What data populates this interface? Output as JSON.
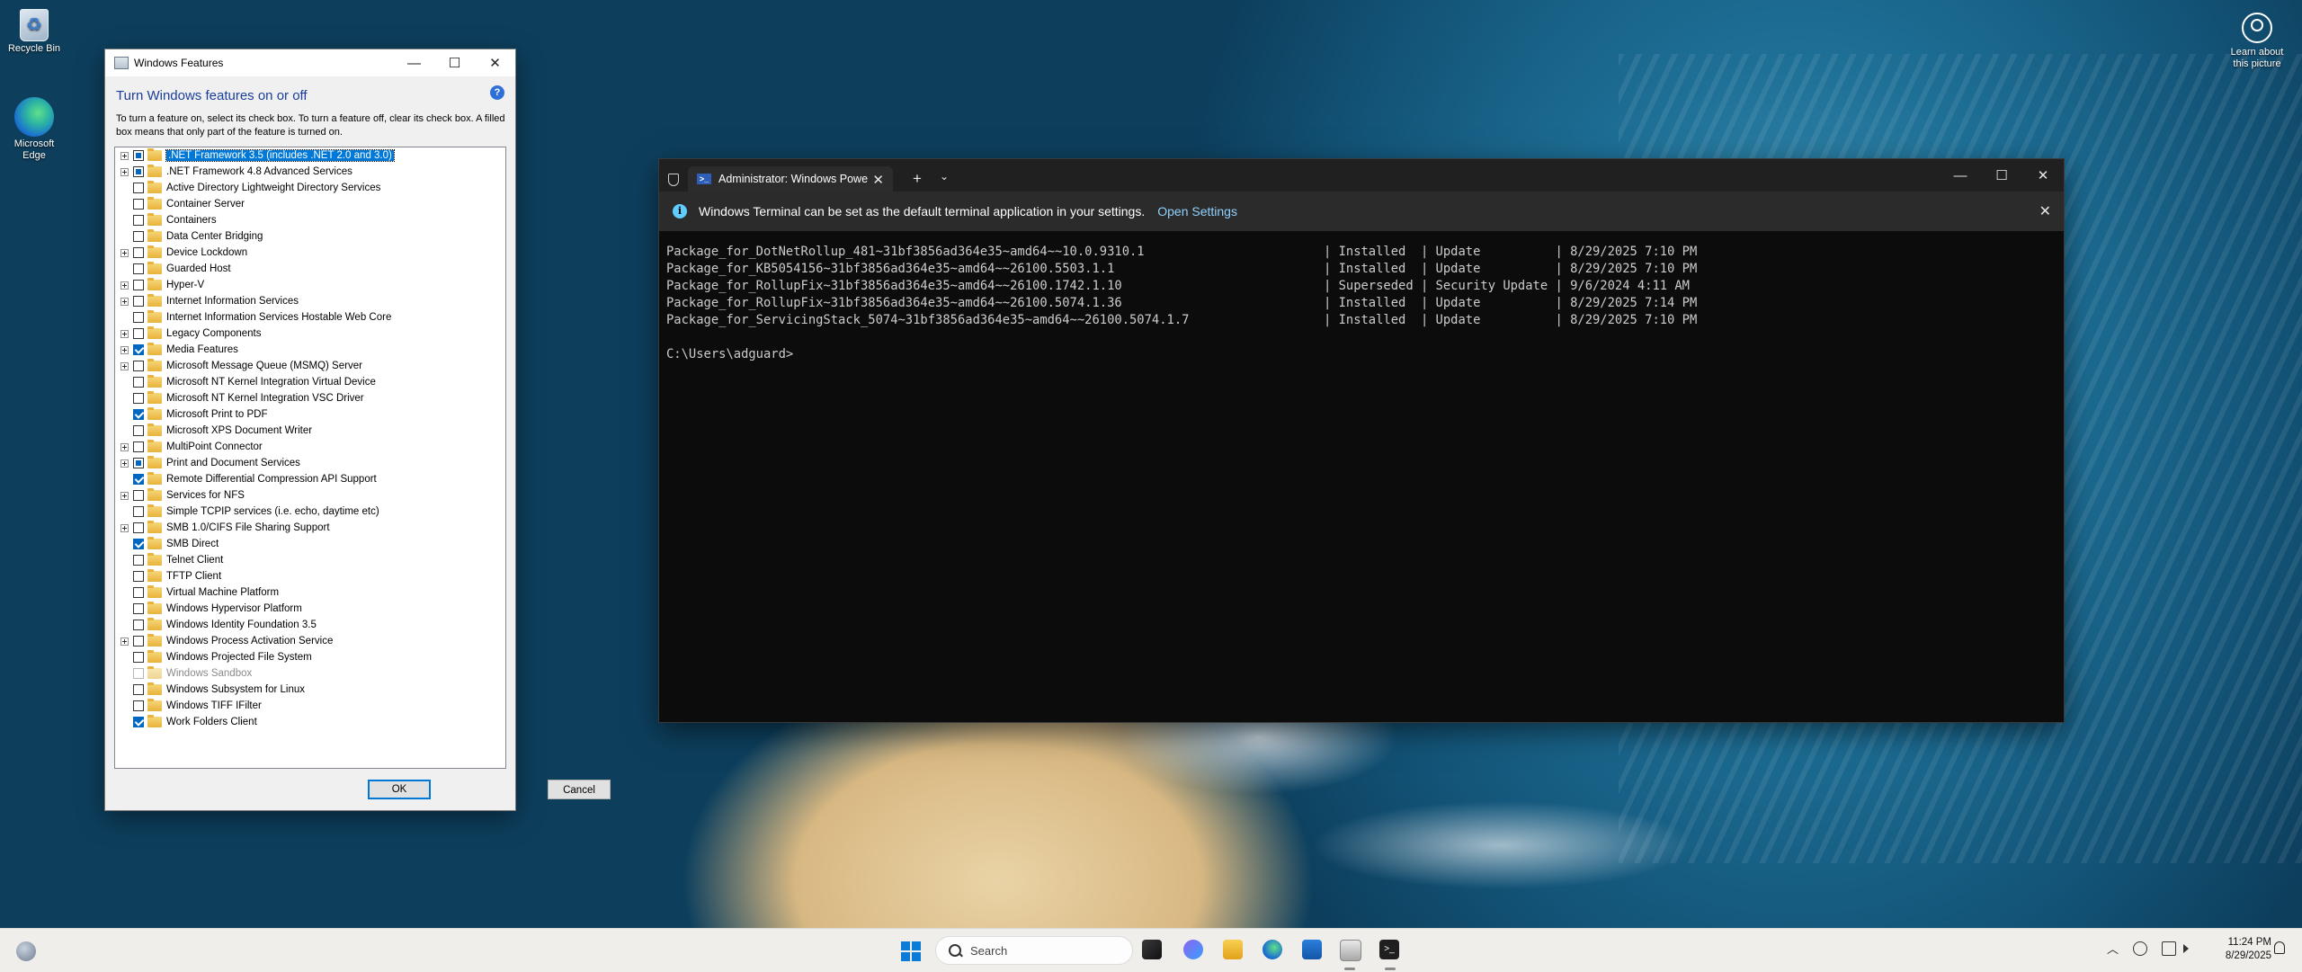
{
  "desktop": {
    "icons": [
      {
        "label": "Recycle Bin"
      },
      {
        "label": "Microsoft Edge"
      }
    ],
    "learn_label": "Learn about this picture"
  },
  "features_window": {
    "title": "Windows Features",
    "heading": "Turn Windows features on or off",
    "description": "To turn a feature on, select its check box. To turn a feature off, clear its check box. A filled box means that only part of the feature is turned on.",
    "items": [
      {
        "label": ".NET Framework 3.5 (includes .NET 2.0 and 3.0)",
        "expand": true,
        "state": "partial",
        "selected": true
      },
      {
        "label": ".NET Framework 4.8 Advanced Services",
        "expand": true,
        "state": "partial"
      },
      {
        "label": "Active Directory Lightweight Directory Services",
        "expand": false,
        "state": "off"
      },
      {
        "label": "Container Server",
        "expand": false,
        "state": "off"
      },
      {
        "label": "Containers",
        "expand": false,
        "state": "off"
      },
      {
        "label": "Data Center Bridging",
        "expand": false,
        "state": "off"
      },
      {
        "label": "Device Lockdown",
        "expand": true,
        "state": "off"
      },
      {
        "label": "Guarded Host",
        "expand": false,
        "state": "off"
      },
      {
        "label": "Hyper-V",
        "expand": true,
        "state": "off"
      },
      {
        "label": "Internet Information Services",
        "expand": true,
        "state": "off"
      },
      {
        "label": "Internet Information Services Hostable Web Core",
        "expand": false,
        "state": "off"
      },
      {
        "label": "Legacy Components",
        "expand": true,
        "state": "off"
      },
      {
        "label": "Media Features",
        "expand": true,
        "state": "checked"
      },
      {
        "label": "Microsoft Message Queue (MSMQ) Server",
        "expand": true,
        "state": "off"
      },
      {
        "label": "Microsoft NT Kernel Integration Virtual Device",
        "expand": false,
        "state": "off"
      },
      {
        "label": "Microsoft NT Kernel Integration VSC Driver",
        "expand": false,
        "state": "off"
      },
      {
        "label": "Microsoft Print to PDF",
        "expand": false,
        "state": "checked"
      },
      {
        "label": "Microsoft XPS Document Writer",
        "expand": false,
        "state": "off"
      },
      {
        "label": "MultiPoint Connector",
        "expand": true,
        "state": "off"
      },
      {
        "label": "Print and Document Services",
        "expand": true,
        "state": "partial"
      },
      {
        "label": "Remote Differential Compression API Support",
        "expand": false,
        "state": "checked"
      },
      {
        "label": "Services for NFS",
        "expand": true,
        "state": "off"
      },
      {
        "label": "Simple TCPIP services (i.e. echo, daytime etc)",
        "expand": false,
        "state": "off"
      },
      {
        "label": "SMB 1.0/CIFS File Sharing Support",
        "expand": true,
        "state": "off"
      },
      {
        "label": "SMB Direct",
        "expand": false,
        "state": "checked"
      },
      {
        "label": "Telnet Client",
        "expand": false,
        "state": "off"
      },
      {
        "label": "TFTP Client",
        "expand": false,
        "state": "off"
      },
      {
        "label": "Virtual Machine Platform",
        "expand": false,
        "state": "off"
      },
      {
        "label": "Windows Hypervisor Platform",
        "expand": false,
        "state": "off"
      },
      {
        "label": "Windows Identity Foundation 3.5",
        "expand": false,
        "state": "off"
      },
      {
        "label": "Windows Process Activation Service",
        "expand": true,
        "state": "off"
      },
      {
        "label": "Windows Projected File System",
        "expand": false,
        "state": "off"
      },
      {
        "label": "Windows Sandbox",
        "expand": false,
        "state": "disabled"
      },
      {
        "label": "Windows Subsystem for Linux",
        "expand": false,
        "state": "off"
      },
      {
        "label": "Windows TIFF IFilter",
        "expand": false,
        "state": "off"
      },
      {
        "label": "Work Folders Client",
        "expand": false,
        "state": "checked"
      }
    ],
    "ok_label": "OK",
    "cancel_label": "Cancel"
  },
  "terminal": {
    "tab_title": "Administrator: Windows Powe",
    "info_text": "Windows Terminal can be set as the default terminal application in your settings.",
    "info_link": "Open Settings",
    "lines": [
      "Package_for_DotNetRollup_481~31bf3856ad364e35~amd64~~10.0.9310.1                        | Installed  | Update          | 8/29/2025 7:10 PM",
      "Package_for_KB5054156~31bf3856ad364e35~amd64~~26100.5503.1.1                            | Installed  | Update          | 8/29/2025 7:10 PM",
      "Package_for_RollupFix~31bf3856ad364e35~amd64~~26100.1742.1.10                           | Superseded | Security Update | 9/6/2024 4:11 AM",
      "Package_for_RollupFix~31bf3856ad364e35~amd64~~26100.5074.1.36                           | Installed  | Update          | 8/29/2025 7:14 PM",
      "Package_for_ServicingStack_5074~31bf3856ad364e35~amd64~~26100.5074.1.7                  | Installed  | Update          | 8/29/2025 7:10 PM",
      "",
      "C:\\Users\\adguard>"
    ]
  },
  "taskbar": {
    "search_placeholder": "Search",
    "time": "11:24 PM",
    "date": "8/29/2025"
  }
}
